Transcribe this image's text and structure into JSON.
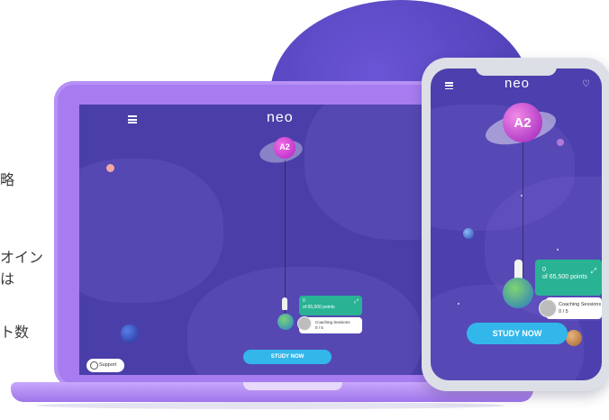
{
  "side_text": {
    "line1": "略",
    "line2": "オイン",
    "line3": "は",
    "line4": "ト数"
  },
  "laptop": {
    "logo": "neo",
    "level_badge": "A2",
    "points_value": "0",
    "points_text": "of 65,500 points",
    "coaching_label": "Coaching Sessions",
    "coaching_value": "0 / 5",
    "study_button": "STUDY NOW",
    "support_button": "Support"
  },
  "phone": {
    "logo": "neo",
    "level_badge": "A2",
    "points_value": "0",
    "points_text": "of 65,500 points",
    "coaching_label": "Coaching Sessions",
    "coaching_value": "0 / 5",
    "study_button": "STUDY NOW"
  },
  "colors": {
    "screen_bg": "#4a3fa8",
    "laptop_frame": "#a77cf0",
    "accent_green": "#29b394",
    "study_blue": "#33b7ea",
    "badge_pink": "#d63fd0"
  }
}
